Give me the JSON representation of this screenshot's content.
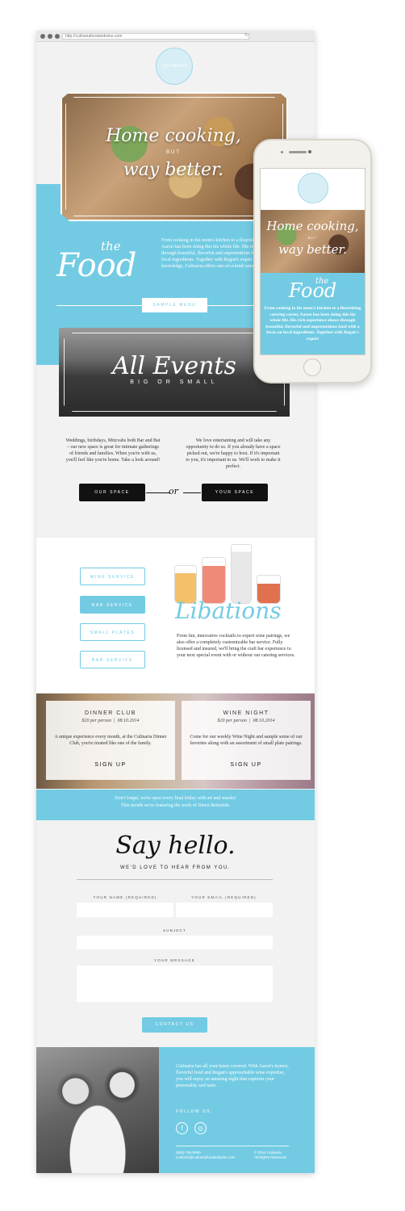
{
  "browser": {
    "url": "http://culinariafoodandwine.com"
  },
  "brand": {
    "logo_text": "CULINARIA"
  },
  "hero": {
    "line1": "Home cooking,",
    "line2": "BUT",
    "line3": "way better."
  },
  "food": {
    "the": "the",
    "title": "Food",
    "text": "From cooking in his mom's kitchen to a flourishing catering career, Aaron has been doing this his whole life. His rich experience shows through beautiful, flavorful and unpretentious food with a focus on local ingredients. Together with Regan's expert wine and cocktail knowledge, Culinaria offers one-of-a-kind catering.",
    "button": "SAMPLE MENU"
  },
  "events": {
    "title": "All Events",
    "subtitle": "BIG OR SMALL",
    "left_text": "Weddings, birthdays, Mitzvahs both Bar and Bat – our new space is great for intimate gatherings of friends and families. When you're with us, you'll feel like you're home. Take a look around!",
    "right_text": "We love entertaining and will take any opportunity to do so. If you already have a space picked out, we're happy to host. If it's important to you, it's important to us. We'll work to make it perfect.",
    "our_space": "OUR SPACE",
    "or": "or",
    "your_space": "YOUR SPACE"
  },
  "libations": {
    "buttons": [
      "WINE SERVICE",
      "BAR SERVICE",
      "SMALL PLATES",
      "BAR SERVICE"
    ],
    "title": "Libations",
    "text": "From fun, innovative cocktails to expert wine pairings, we also offer a completely customizable bar service. Fully licensed and insured, we'll bring the craft bar experience to your next special event with or without our catering services."
  },
  "cards": {
    "dinner": {
      "title": "DINNER CLUB",
      "price": "$20 per person",
      "date": "08.10.2014",
      "text": "A unique experience every month, at the Culinaria Dinner Club, you're treated like one of the family.",
      "signup": "SIGN UP"
    },
    "wine": {
      "title": "WINE NIGHT",
      "price": "$20 per person",
      "date": "08.10.2014",
      "text": "Come for our weekly Wine Night and sample some of our favorites along with an assortment of small plate pairings.",
      "signup": "SIGN UP"
    }
  },
  "notice": {
    "line1": "Don't forget, we're open every final friday with art and snacks!",
    "line2": "This month we're featuring the work of Dawn Bertoletti."
  },
  "contact": {
    "title": "Say hello.",
    "subtitle": "WE'D LOVE TO HEAR FROM YOU.",
    "name_label": "YOUR NAME (REQUIRED)",
    "email_label": "YOUR EMAIL (REQUIRED)",
    "subject_label": "SUBJECT",
    "message_label": "YOUR MESSAGE",
    "button": "CONTACT US"
  },
  "footer": {
    "text": "Culinaria has all your bases covered. With Aaron's honest, flavorful food and Regan's approachable wine expertise, you will enjoy an amazing night that captures your personality and taste.",
    "follow": "FOLLOW US:",
    "facebook_icon": "f",
    "instagram_icon": "◎",
    "phone": "(555) 784-8989",
    "email": "culinaria@culinariafoodandwine.com",
    "copyright": "© 2014 Culinaria",
    "rights": "All Rights Reserved"
  },
  "phone": {
    "hero_line1": "Home cooking,",
    "hero_line2": "BUT",
    "hero_line3": "way better.",
    "the": "the",
    "food": "Food",
    "text": "From cooking in his mom's kitchen to a flourishing catering career, Aaron has been doing this his whole life. His rich experience shows through beautiful, flavorful and unpretentious food with a focus on local ingredients. Together with Regan's expert"
  },
  "colors": {
    "accent": "#72cbe3",
    "dark": "#111111",
    "panel": "#f2f2f2"
  }
}
